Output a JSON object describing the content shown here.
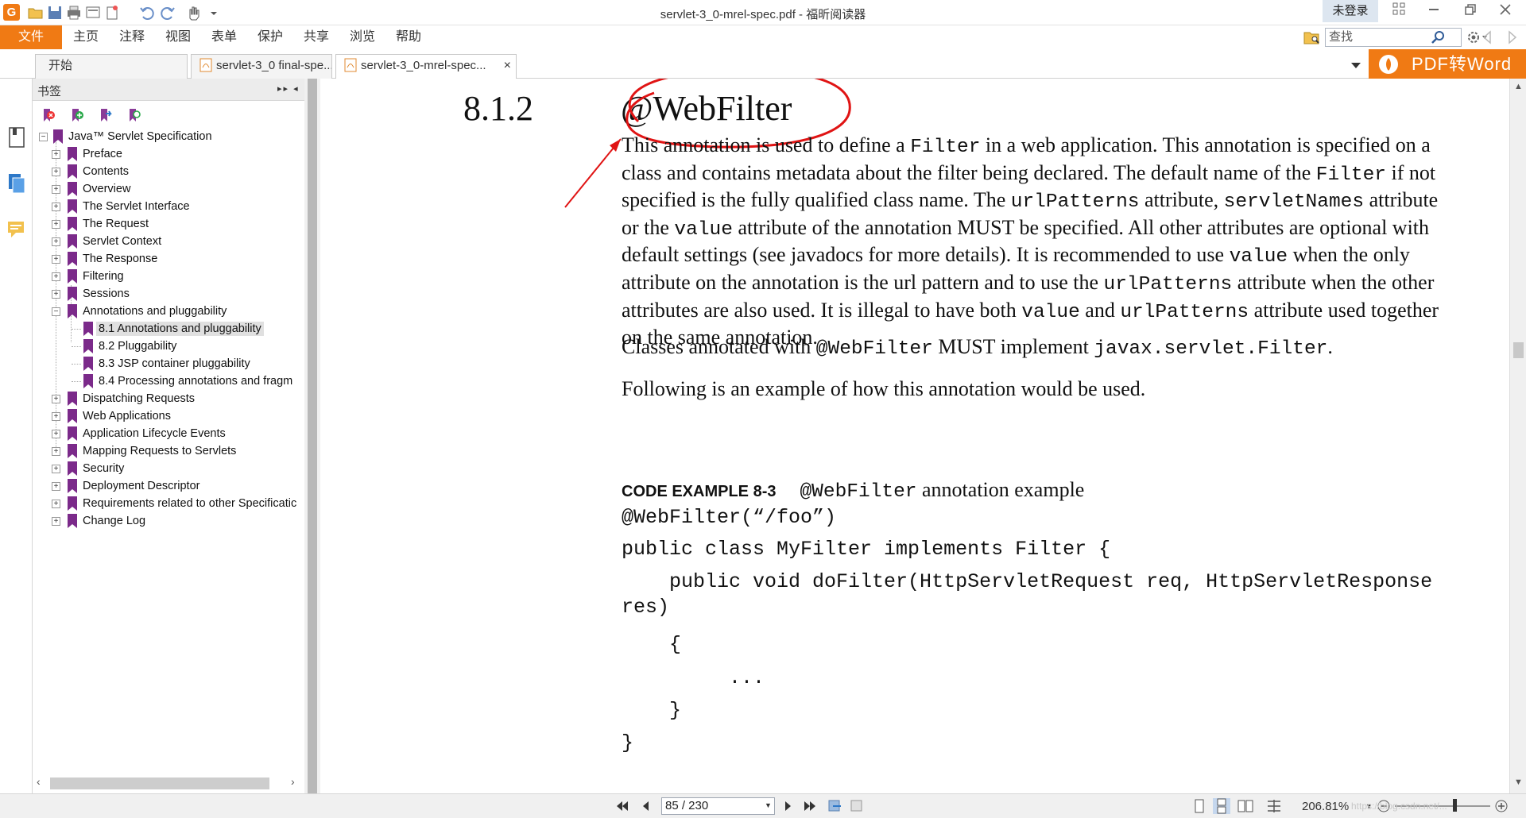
{
  "window": {
    "title": "servlet-3_0-mrel-spec.pdf - 福昕阅读器",
    "login": "未登录",
    "app_logo": "G"
  },
  "menu": {
    "file": "文件",
    "items": [
      "主页",
      "注释",
      "视图",
      "表单",
      "保护",
      "共享",
      "浏览",
      "帮助"
    ]
  },
  "search": {
    "placeholder": "查找"
  },
  "tabs": [
    {
      "label": "开始"
    },
    {
      "label": "servlet-3_0 final-spe..."
    },
    {
      "label": "servlet-3_0-mrel-spec..."
    }
  ],
  "tab_close": "×",
  "promo": {
    "label": "PDF转Word"
  },
  "bookmarks": {
    "title": "书签",
    "collapse": "▸▸ ◂",
    "items": [
      {
        "label": "Java™ Servlet Specification"
      },
      {
        "label": "Preface"
      },
      {
        "label": "Contents"
      },
      {
        "label": "Overview"
      },
      {
        "label": "The Servlet Interface"
      },
      {
        "label": "The Request"
      },
      {
        "label": "Servlet Context"
      },
      {
        "label": "The Response"
      },
      {
        "label": "Filtering"
      },
      {
        "label": "Sessions"
      },
      {
        "label": "Annotations and pluggability"
      },
      {
        "label": "8.1 Annotations and pluggability"
      },
      {
        "label": "8.2 Pluggability"
      },
      {
        "label": "8.3 JSP container pluggability"
      },
      {
        "label": "8.4 Processing annotations and fragm"
      },
      {
        "label": "Dispatching Requests"
      },
      {
        "label": "Web Applications"
      },
      {
        "label": "Application Lifecycle Events"
      },
      {
        "label": "Mapping Requests to Servlets"
      },
      {
        "label": "Security"
      },
      {
        "label": "Deployment Descriptor"
      },
      {
        "label": "Requirements related to other Specificatic"
      },
      {
        "label": "Change Log"
      }
    ],
    "selected_index": 11
  },
  "document": {
    "section_number": "8.1.2",
    "section_title": "@WebFilter",
    "para1": [
      {
        "t": "This annotation is used to define a "
      },
      {
        "m": "Filter"
      },
      {
        "t": " in a web application. This annotation is specified on a class and contains metadata about the filter being declared. The default name of the "
      },
      {
        "m": "Filter"
      },
      {
        "t": " if not specified is the fully qualified class name. The "
      },
      {
        "m": "urlPatterns"
      },
      {
        "t": " attribute, "
      },
      {
        "m": "servletNames"
      },
      {
        "t": " attribute or the "
      },
      {
        "m": "value"
      },
      {
        "t": " attribute of the annotation MUST be specified. All other attributes are optional with default settings (see javadocs for more details). It is recommended to use "
      },
      {
        "m": "value"
      },
      {
        "t": " when the only attribute on the annotation is the url pattern and to use the "
      },
      {
        "m": "urlPatterns"
      },
      {
        "t": " attribute when the other attributes are also used. It is illegal to have both "
      },
      {
        "m": "value"
      },
      {
        "t": " and "
      },
      {
        "m": "urlPatterns"
      },
      {
        "t": " attribute used together on the same annotation."
      }
    ],
    "para2": [
      {
        "t": "Classes annotated with "
      },
      {
        "m": "@WebFilter"
      },
      {
        "t": " MUST implement "
      },
      {
        "m": "javax.servlet.Filter"
      },
      {
        "t": "."
      }
    ],
    "para3": "Following is an example of how this annotation would be used.",
    "code_caption_label": "CODE EXAMPLE 8-3",
    "code_caption_mono": "@WebFilter",
    "code_caption_text": " annotation example",
    "code_lines": [
      "@WebFilter(“/foo”)",
      "public class MyFilter implements Filter {",
      "    public void doFilter(HttpServletRequest req, HttpServletResponse",
      "res)",
      "    {",
      "         ...",
      "    }",
      "}"
    ]
  },
  "status": {
    "page": "85 / 230",
    "zoom": "206.81%",
    "watermark": "https://blog.csdn.net/..."
  },
  "colors": {
    "accent": "#f07a14",
    "annotation_red": "#e01414",
    "bookmark_purple": "#7b2a8a"
  }
}
